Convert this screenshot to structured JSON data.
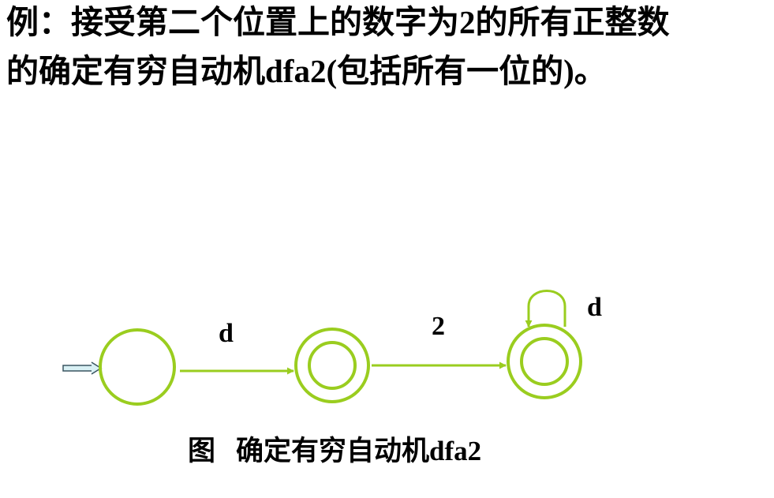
{
  "heading": {
    "line1_prefix": "例：接受第二个位置上的数字为",
    "line1_digit": "2",
    "line1_suffix": "的所有正整数",
    "line2_prefix": "的确定有穷自动机",
    "line2_name": "dfa2(",
    "line2_middle": "包括所有一位的",
    "line2_close": ")",
    "line2_end": "。"
  },
  "diagram": {
    "edges": [
      {
        "from": "q0",
        "to": "q1",
        "label": "d"
      },
      {
        "from": "q1",
        "to": "q2",
        "label": "2"
      },
      {
        "from": "q2",
        "to": "q2",
        "label": "d"
      }
    ],
    "states": [
      {
        "id": "q0",
        "accepting": false,
        "start": true
      },
      {
        "id": "q1",
        "accepting": true,
        "start": false
      },
      {
        "id": "q2",
        "accepting": true,
        "start": false
      }
    ],
    "colors": {
      "state_stroke": "#9acd1f",
      "edge_stroke": "#9acd1f",
      "start_arrow_fill": "#d8f0f4",
      "start_arrow_stroke": "#3a5560"
    }
  },
  "caption": {
    "prefix": "图",
    "text": "确定有穷自动机",
    "name": "dfa2"
  }
}
